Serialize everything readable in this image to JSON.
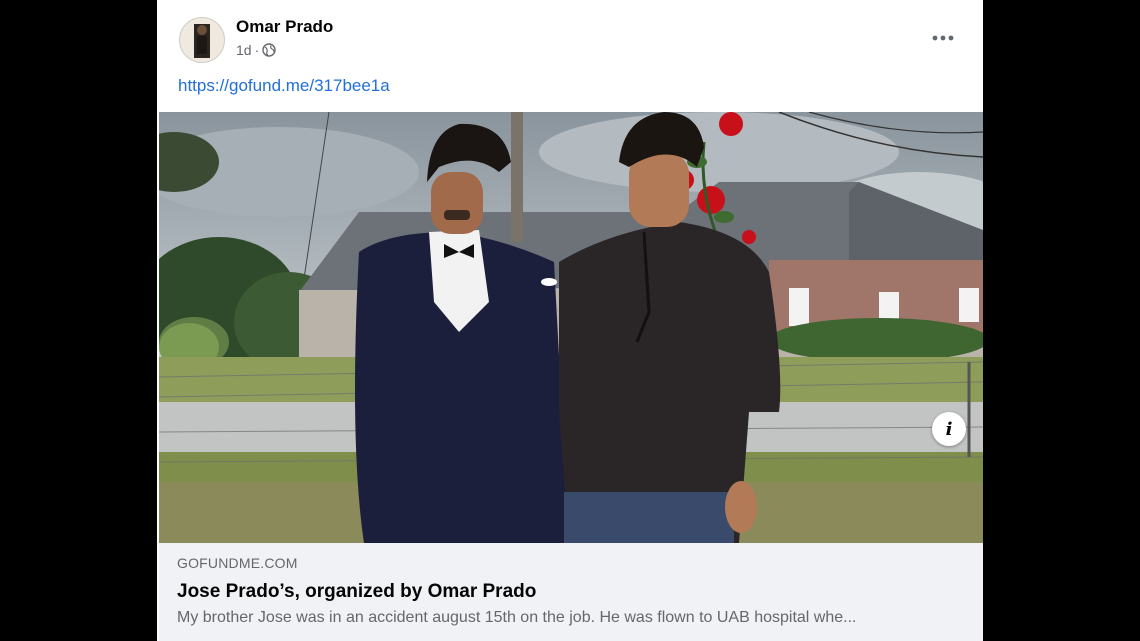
{
  "post": {
    "author": "Omar Prado",
    "timestamp": "1d",
    "separator": "·",
    "audience_icon": "globe-icon",
    "link_text": "https://gofund.me/317bee1a",
    "more_icon": "more-options-icon"
  },
  "link_preview": {
    "image_description_icon": "info-icon",
    "info_glyph": "i",
    "domain": "GOFUNDME.COM",
    "title": "Jose Prado’s, organized by Omar Prado",
    "description": "My brother Jose was in an accident august 15th on the job. He was flown to UAB hospital whe..."
  },
  "colors": {
    "link": "#216fdb",
    "card_background": "#f0f2f5",
    "secondary_text": "#65676b",
    "primary_text": "#050505"
  }
}
